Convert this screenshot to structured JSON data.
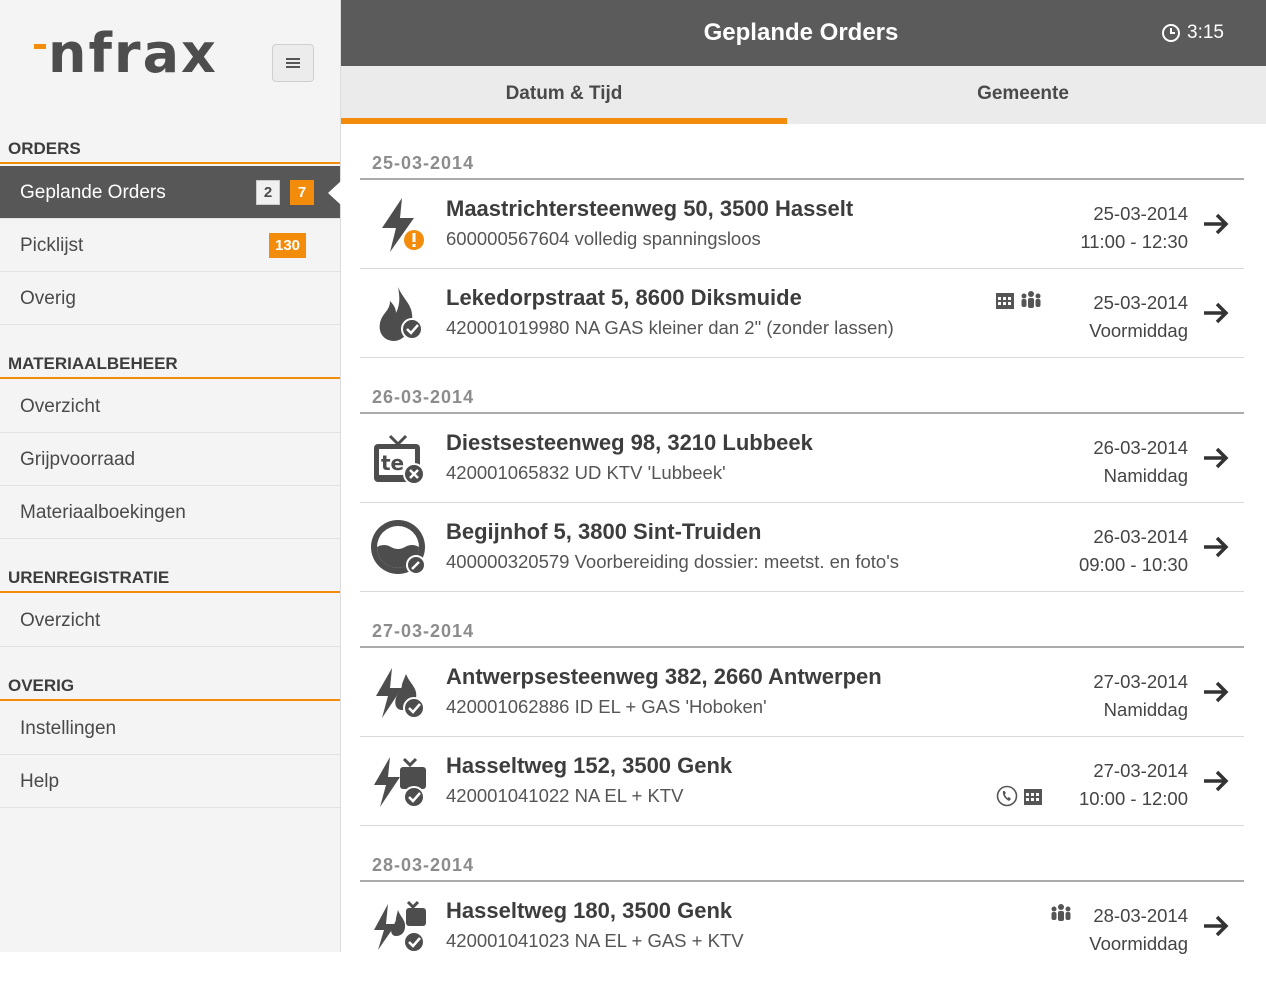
{
  "logo": {
    "text": "nfrax"
  },
  "sidebar": {
    "sections": [
      {
        "title": "ORDERS"
      },
      {
        "title": "MATERIAALBEHEER"
      },
      {
        "title": "URENREGISTRATIE"
      },
      {
        "title": "OVERIG"
      }
    ],
    "orders": [
      {
        "label": "Geplande Orders",
        "badge_grey": "2",
        "badge_orange": "7"
      },
      {
        "label": "Picklijst",
        "badge_orange": "130"
      },
      {
        "label": "Overig"
      }
    ],
    "materiaal": [
      {
        "label": "Overzicht"
      },
      {
        "label": "Grijpvoorraad"
      },
      {
        "label": "Materiaalboekingen"
      }
    ],
    "uren": [
      {
        "label": "Overzicht"
      }
    ],
    "overig": [
      {
        "label": "Instellingen"
      },
      {
        "label": "Help"
      }
    ]
  },
  "header": {
    "title": "Geplande Orders",
    "clock": "3:15"
  },
  "tabs": [
    {
      "label": "Datum & Tijd",
      "active": true
    },
    {
      "label": "Gemeente",
      "active": false
    }
  ],
  "groups": [
    {
      "date": "25-03-2014",
      "orders": [
        {
          "icon": "electricity-warning-icon",
          "address": "Maastrichtersteenweg 50, 3500 Hasselt",
          "desc": "600000567604 volledig spanningsloos",
          "date": "25-03-2014",
          "time": "11:00 - 12:30",
          "extras": []
        },
        {
          "icon": "gas-check-icon",
          "address": "Lekedorpstraat 5, 8600 Diksmuide",
          "desc": "420001019980 NA GAS kleiner dan 2\" (zonder lassen)",
          "date": "25-03-2014",
          "time": "Voormiddag",
          "extras": [
            "calendar-icon",
            "people-icon"
          ]
        }
      ]
    },
    {
      "date": "26-03-2014",
      "orders": [
        {
          "icon": "tv-cancel-icon",
          "address": "Diestsesteenweg 98, 3210 Lubbeek",
          "desc": "420001065832 UD KTV 'Lubbeek'",
          "date": "26-03-2014",
          "time": "Namiddag",
          "extras": []
        },
        {
          "icon": "water-meter-icon",
          "address": "Begijnhof 5, 3800 Sint-Truiden",
          "desc": "400000320579 Voorbereiding dossier: meetst. en foto's",
          "date": "26-03-2014",
          "time": "09:00 - 10:30",
          "extras": []
        }
      ]
    },
    {
      "date": "27-03-2014",
      "orders": [
        {
          "icon": "electricity-gas-check-icon",
          "address": "Antwerpsesteenweg 382, 2660 Antwerpen",
          "desc": "420001062886 ID EL + GAS 'Hoboken'",
          "date": "27-03-2014",
          "time": "Namiddag",
          "extras": []
        },
        {
          "icon": "electricity-tv-check-icon",
          "address": "Hasseltweg 152, 3500 Genk",
          "desc": "420001041022 NA EL + KTV",
          "date": "27-03-2014",
          "time": "10:00 - 12:00",
          "extras": [
            "phone-icon",
            "calendar-icon"
          ]
        }
      ]
    },
    {
      "date": "28-03-2014",
      "orders": [
        {
          "icon": "electricity-gas-tv-check-icon",
          "address": "Hasseltweg 180, 3500 Genk",
          "desc": "420001041023 NA EL + GAS + KTV",
          "date": "28-03-2014",
          "time": "Voormiddag",
          "extras": [
            "people-icon"
          ]
        }
      ]
    }
  ],
  "colors": {
    "accent": "#f28c0a",
    "header": "#5b5b5b",
    "active_nav": "#575757",
    "text": "#3d3d3d"
  }
}
